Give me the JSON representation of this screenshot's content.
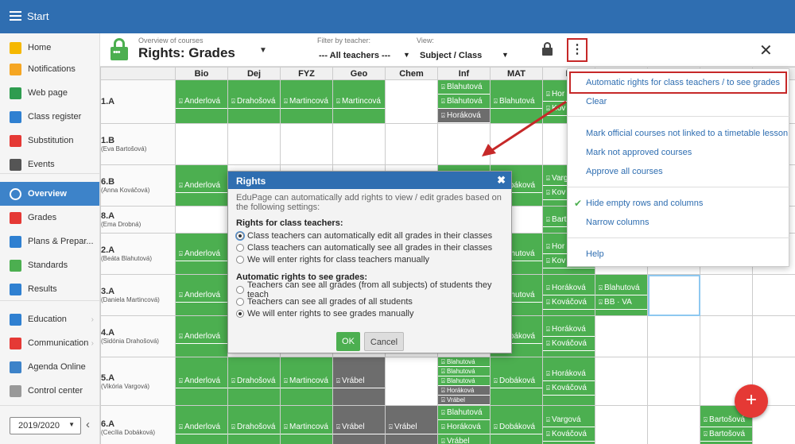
{
  "topbar": {
    "title": "Start"
  },
  "sidebar": {
    "items": [
      {
        "label": "Home",
        "icon": "star-icon",
        "color": "#f5b800"
      },
      {
        "label": "Notifications",
        "icon": "envelope-icon",
        "color": "#f5a623"
      },
      {
        "label": "Web page",
        "icon": "house-icon",
        "color": "#2e9c4f"
      },
      {
        "label": "Class register",
        "icon": "notebook-icon",
        "color": "#2f80d1"
      },
      {
        "label": "Substitution",
        "icon": "person-swap-icon",
        "color": "#e53935"
      },
      {
        "label": "Events",
        "icon": "calendar-icon",
        "color": "#555555"
      },
      {
        "label": "Overview",
        "icon": "check-circle-icon",
        "color": "#ffffff"
      },
      {
        "label": "Grades",
        "icon": "grades-icon",
        "color": "#e53935"
      },
      {
        "label": "Plans & Prepar...",
        "icon": "briefcase-icon",
        "color": "#2f80d1"
      },
      {
        "label": "Standards",
        "icon": "shield-check-icon",
        "color": "#4caf50"
      },
      {
        "label": "Results",
        "icon": "bar-chart-icon",
        "color": "#2f80d1"
      },
      {
        "label": "Education",
        "icon": "book-icon",
        "color": "#2f80d1"
      },
      {
        "label": "Communication",
        "icon": "chat-icon",
        "color": "#e53935"
      },
      {
        "label": "Agenda Online",
        "icon": "pen-icon",
        "color": "#3d83c9"
      },
      {
        "label": "Control center",
        "icon": "gear-icon",
        "color": "#999999"
      }
    ],
    "year": "2019/2020"
  },
  "header": {
    "subtitle": "Overview of courses",
    "title": "Rights: Grades",
    "filter_label": "Filter by teacher:",
    "filter_value": "--- All teachers ---",
    "view_label": "View:",
    "view_value": "Subject / Class"
  },
  "grid": {
    "columns": [
      "Bio",
      "Dej",
      "FYZ",
      "Geo",
      "Chem",
      "Inf",
      "MAT",
      "N"
    ],
    "rows": [
      {
        "cls": "1.A",
        "teacher": "",
        "cells": [
          [
            {
              "t": "Anderlová"
            }
          ],
          [
            {
              "t": "Drahošová"
            }
          ],
          [
            {
              "t": "Martincová"
            }
          ],
          [
            {
              "t": "Martincová"
            }
          ],
          [],
          [
            {
              "t": "Blahutová"
            },
            {
              "t": "Blahutová"
            },
            {
              "t": "Horáková",
              "g": true
            }
          ],
          [
            {
              "t": "Blahutová"
            }
          ],
          [
            {
              "t": "Hor"
            },
            {
              "t": "Kov"
            }
          ]
        ]
      },
      {
        "cls": "1.B",
        "teacher": "(Eva Bartošová)",
        "cells": [
          [],
          [],
          [],
          [],
          [],
          [],
          [],
          []
        ]
      },
      {
        "cls": "6.B",
        "teacher": "(Anna Kováčová)",
        "cells": [
          [
            {
              "t": "Anderlová"
            }
          ],
          [],
          [],
          [],
          [],
          [
            {
              "t": "Blahutová"
            }
          ],
          [
            {
              "t": "Dobáková"
            }
          ],
          [
            {
              "t": "Varg"
            },
            {
              "t": "Kov"
            }
          ]
        ]
      },
      {
        "cls": "8.A",
        "teacher": "(Ema Drobná)",
        "cells": [
          [],
          [],
          [],
          [],
          [],
          [],
          [],
          [
            {
              "t": "Bart"
            }
          ]
        ]
      },
      {
        "cls": "2.A",
        "teacher": "(Beáta Blahutová)",
        "cells": [
          [
            {
              "t": "Anderlová"
            }
          ],
          [],
          [],
          [],
          [],
          [],
          [
            {
              "t": "Blahutová"
            }
          ],
          [
            {
              "t": "Hor"
            },
            {
              "t": "Kov"
            }
          ]
        ]
      },
      {
        "cls": "3.A",
        "teacher": "(Daniela Martincová)",
        "cells": [
          [
            {
              "t": "Anderlová"
            }
          ],
          [],
          [],
          [],
          [],
          [],
          [
            {
              "t": "Blahutová"
            }
          ],
          [
            {
              "t": "Horáková"
            },
            {
              "t": "Kováčová"
            }
          ]
        ]
      },
      {
        "cls": "4.A",
        "teacher": "(Sidónia Drahošová)",
        "cells": [
          [
            {
              "t": "Anderlová"
            }
          ],
          [],
          [],
          [],
          [],
          [],
          [
            {
              "t": "Dobáková"
            }
          ],
          [
            {
              "t": "Horáková"
            },
            {
              "t": "Kováčová"
            }
          ]
        ]
      },
      {
        "cls": "5.A",
        "teacher": "(Vikória Vargová)",
        "cells": [
          [
            {
              "t": "Anderlová"
            }
          ],
          [
            {
              "t": "Drahošová"
            }
          ],
          [
            {
              "t": "Martincová"
            }
          ],
          [
            {
              "t": "Vrábel",
              "g": true
            }
          ],
          [],
          [
            {
              "t": "Blahutová"
            },
            {
              "t": "Blahutová"
            },
            {
              "t": "Blahutová"
            },
            {
              "t": "Horáková",
              "g": true
            },
            {
              "t": "Vrábel",
              "g": true
            }
          ],
          [
            {
              "t": "Dobáková"
            }
          ],
          [
            {
              "t": "Horáková"
            },
            {
              "t": "Kováčová"
            }
          ]
        ]
      },
      {
        "cls": "6.A",
        "teacher": "(Cecília Dobáková)",
        "cells": [
          [
            {
              "t": "Anderlová"
            }
          ],
          [
            {
              "t": "Drahošová"
            }
          ],
          [
            {
              "t": "Martincová"
            }
          ],
          [
            {
              "t": "Vrábel",
              "g": true
            }
          ],
          [
            {
              "t": "Vrábel",
              "g": true
            }
          ],
          [
            {
              "t": "Blahutová"
            },
            {
              "t": "Horáková"
            },
            {
              "t": "Vrábel"
            }
          ],
          [
            {
              "t": "Dobáková"
            }
          ],
          [
            {
              "t": "Vargová"
            },
            {
              "t": "Kováčová"
            }
          ]
        ]
      }
    ],
    "extra": {
      "row3A_col9": [
        "Blahutová",
        "BB · VA"
      ],
      "row6A_col10": [
        "Bartošová",
        "Bartošová"
      ]
    }
  },
  "dropdown": {
    "items": [
      "Automatic rights for class teachers / to see grades",
      "Clear",
      "Mark official courses not linked to a timetable lesson",
      "Mark not approved courses",
      "Approve all courses",
      "Hide empty rows and columns",
      "Narrow columns",
      "Help"
    ]
  },
  "dialog": {
    "title": "Rights",
    "description": "EduPage can automatically add rights to view / edit grades based on the following settings:",
    "section1_title": "Rights for class teachers:",
    "section1_options": [
      "Class teachers can automatically edit all grades in their classes",
      "Class teachers can automatically see all grades in their classes",
      "We will enter rights for class teachers manually"
    ],
    "section2_title": "Automatic rights to see grades:",
    "section2_options": [
      "Teachers can see all grades (from all subjects) of students they teach",
      "Teachers can see all grades of all students",
      "We will enter rights to see grades manually"
    ],
    "ok": "OK",
    "cancel": "Cancel"
  },
  "colors": {
    "accent": "#2f6eb1",
    "green": "#4caf50",
    "gray_chip": "#6d6d6d",
    "highlight": "#c62828",
    "fab": "#e53935"
  }
}
